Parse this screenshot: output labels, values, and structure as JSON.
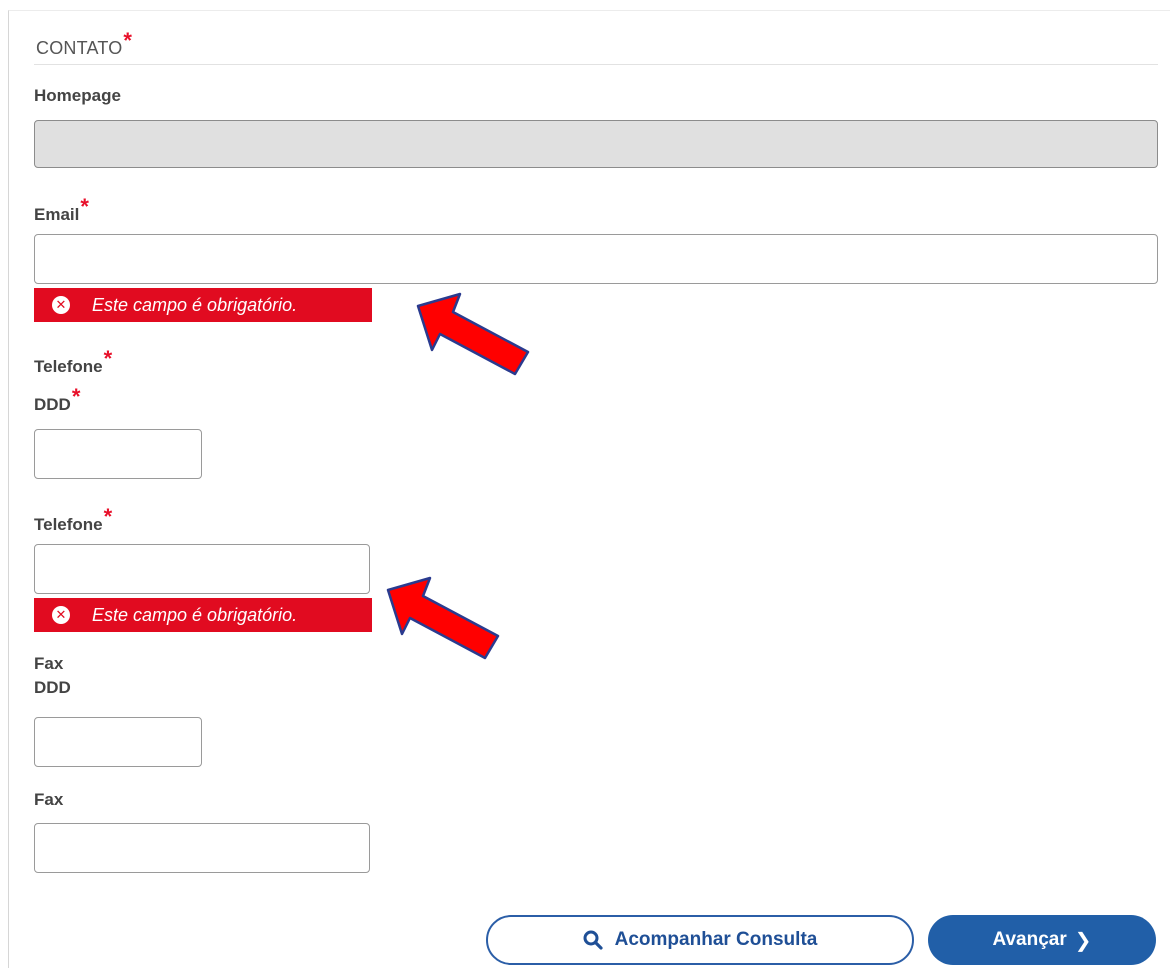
{
  "section": {
    "title": "CONTATO",
    "required_mark": "*"
  },
  "fields": {
    "homepage": {
      "label": "Homepage",
      "value": "",
      "disabled": true
    },
    "email": {
      "label": "Email",
      "required_mark": "*",
      "value": "",
      "error": "Este campo é obrigatório."
    },
    "telefone_group": {
      "label": "Telefone",
      "required_mark": "*"
    },
    "telefone_ddd": {
      "label": "DDD",
      "required_mark": "*",
      "value": ""
    },
    "telefone": {
      "label": "Telefone",
      "required_mark": "*",
      "value": "",
      "error": "Este campo é obrigatório."
    },
    "fax_group": {
      "label": "Fax"
    },
    "fax_ddd": {
      "label": "DDD",
      "value": ""
    },
    "fax": {
      "label": "Fax",
      "value": ""
    }
  },
  "actions": {
    "acompanhar_label": "Acompanhar Consulta",
    "acompanhar_icon": "search-icon",
    "avancar_label": "Avançar",
    "avancar_icon": "chevron-right-icon"
  },
  "annotations": {
    "arrow_color": "#ff0000",
    "arrow_outline": "#2a3b8f"
  },
  "colors": {
    "error_bg": "#e10b20",
    "primary": "#215fa8",
    "required": "#e8102a"
  }
}
